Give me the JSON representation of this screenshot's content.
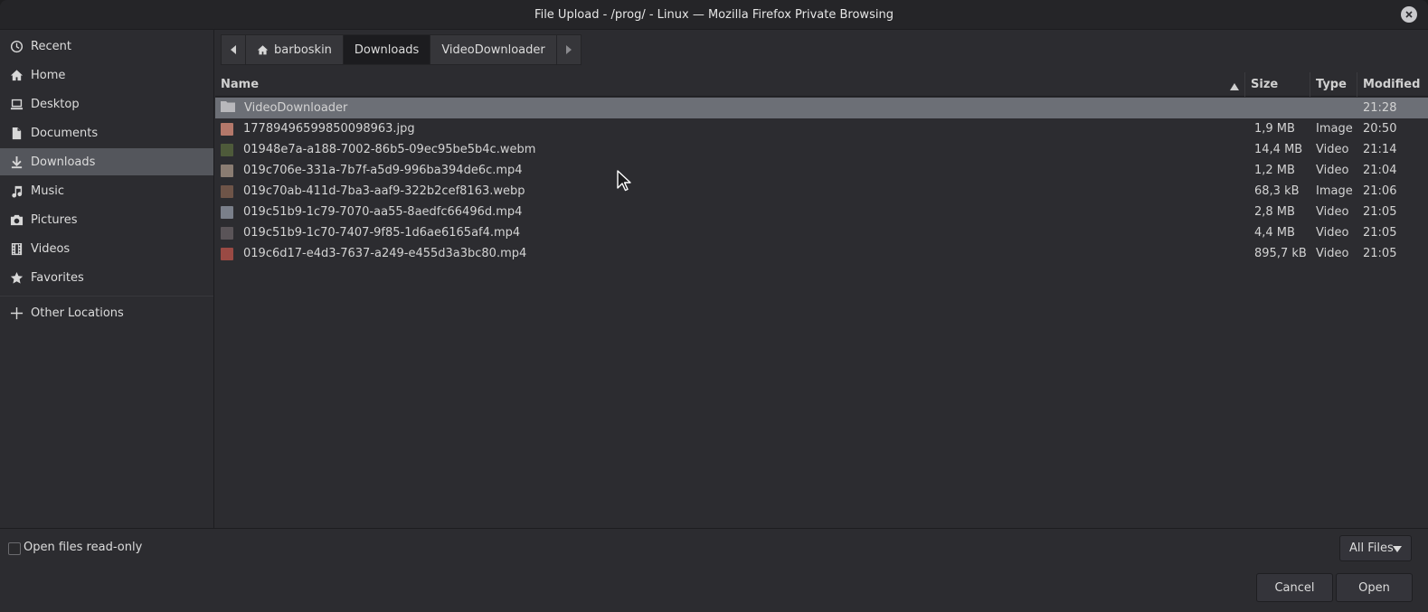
{
  "window": {
    "title": "File Upload - /prog/ - Linux — Mozilla Firefox Private Browsing"
  },
  "sidebar": {
    "items": [
      {
        "label": "Recent",
        "icon": "clock-icon"
      },
      {
        "label": "Home",
        "icon": "home-icon"
      },
      {
        "label": "Desktop",
        "icon": "desktop-icon"
      },
      {
        "label": "Documents",
        "icon": "document-icon"
      },
      {
        "label": "Downloads",
        "icon": "download-icon",
        "active": true
      },
      {
        "label": "Music",
        "icon": "music-icon"
      },
      {
        "label": "Pictures",
        "icon": "camera-icon"
      },
      {
        "label": "Videos",
        "icon": "film-icon"
      },
      {
        "label": "Favorites",
        "icon": "star-icon"
      }
    ],
    "other_locations": "Other Locations"
  },
  "pathbar": {
    "crumbs": [
      "barboskin",
      "Downloads",
      "VideoDownloader"
    ],
    "active_index": 1
  },
  "columns": {
    "name": "Name",
    "size": "Size",
    "type": "Type",
    "modified": "Modified"
  },
  "files": [
    {
      "name": "VideoDownloader",
      "size": "",
      "type": "",
      "modified": "21:28",
      "kind": "folder",
      "selected": true,
      "thumb": "#b8b8bc"
    },
    {
      "name": "17789496599850098963.jpg",
      "size": "1,9 MB",
      "type": "Image",
      "modified": "20:50",
      "kind": "file",
      "thumb": "#b4786a"
    },
    {
      "name": "01948e7a-a188-7002-86b5-09ec95be5b4c.webm",
      "size": "14,4 MB",
      "type": "Video",
      "modified": "21:14",
      "kind": "file",
      "thumb": "#4e5a3a"
    },
    {
      "name": "019c706e-331a-7b7f-a5d9-996ba394de6c.mp4",
      "size": "1,2 MB",
      "type": "Video",
      "modified": "21:04",
      "kind": "file",
      "thumb": "#8a7c72"
    },
    {
      "name": "019c70ab-411d-7ba3-aaf9-322b2cef8163.webp",
      "size": "68,3 kB",
      "type": "Image",
      "modified": "21:06",
      "kind": "file",
      "thumb": "#6e5448"
    },
    {
      "name": "019c51b9-1c79-7070-aa55-8aedfc66496d.mp4",
      "size": "2,8 MB",
      "type": "Video",
      "modified": "21:05",
      "kind": "file",
      "thumb": "#7a7f8a"
    },
    {
      "name": "019c51b9-1c70-7407-9f85-1d6ae6165af4.mp4",
      "size": "4,4 MB",
      "type": "Video",
      "modified": "21:05",
      "kind": "file",
      "thumb": "#5a5458"
    },
    {
      "name": "019c6d17-e4d3-7637-a249-e455d3a3bc80.mp4",
      "size": "895,7 kB",
      "type": "Video",
      "modified": "21:05",
      "kind": "file",
      "thumb": "#9a4a44"
    }
  ],
  "footer": {
    "readonly_label": "Open files read-only",
    "filter_label": "All Files",
    "cancel_label": "Cancel",
    "open_label": "Open"
  },
  "colors": {
    "window_bg": "#2c2c30",
    "selected_row": "#6c6f76",
    "active_sidebar": "#54565c"
  }
}
